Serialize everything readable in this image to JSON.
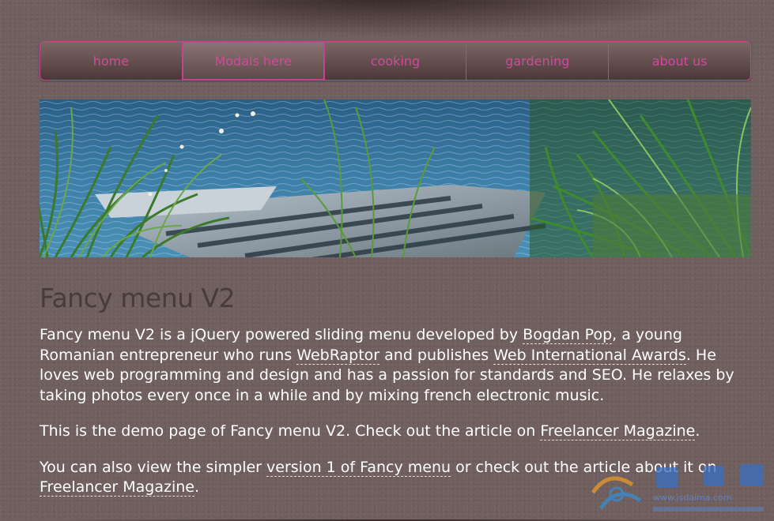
{
  "nav": {
    "items": [
      {
        "label": "home"
      },
      {
        "label": "Modals here"
      },
      {
        "label": "cooking"
      },
      {
        "label": "gardening"
      },
      {
        "label": "about us"
      }
    ],
    "active_index": 1,
    "accent_color": "#d04a9c"
  },
  "banner": {
    "image_desc_icon": "lake-pier-image"
  },
  "title": "Fancy menu V2",
  "p1": {
    "t1": "Fancy menu V2 is a jQuery powered sliding menu developed by ",
    "link1": "Bogdan Pop",
    "t2": ", a young Romanian entrepreneur who runs ",
    "link2": "WebRaptor",
    "t3": " and publishes ",
    "link3": "Web International Awards",
    "t4": ". He loves web programming and design and has a passion for standards and SEO. He relaxes by taking photos every once in a while and by mixing french electronic music."
  },
  "p2": {
    "t1": "This is the demo page of Fancy menu V2. Check out the article on ",
    "link1": "Freelancer Magazine",
    "t2": "."
  },
  "p3": {
    "t1": "You can also view the simpler ",
    "link1": "version 1 of Fancy menu",
    "t2": " or check out the article about it on ",
    "link2": "Freelancer Magazine",
    "t3": "."
  },
  "watermark": {
    "text": "www.jsdaima.com",
    "icon": "site-logo-icon"
  }
}
